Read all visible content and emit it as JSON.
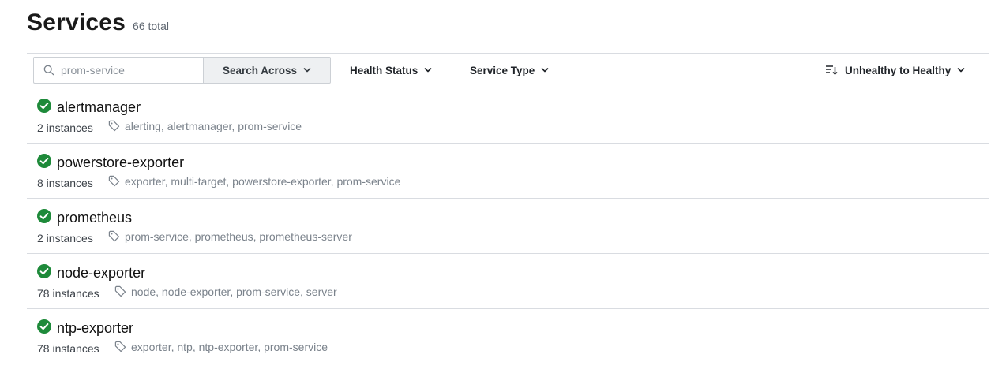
{
  "header": {
    "title": "Services",
    "total": "66 total"
  },
  "filters": {
    "search_placeholder": "prom-service",
    "search_across": "Search Across",
    "health_status": "Health Status",
    "service_type": "Service Type",
    "sort": "Unhealthy to Healthy"
  },
  "colors": {
    "healthy": "#1e8a3a"
  },
  "services": [
    {
      "name": "alertmanager",
      "instances": "2 instances",
      "tags": "alerting, alertmanager, prom-service",
      "status": "healthy"
    },
    {
      "name": "powerstore-exporter",
      "instances": "8 instances",
      "tags": "exporter, multi-target, powerstore-exporter, prom-service",
      "status": "healthy"
    },
    {
      "name": "prometheus",
      "instances": "2 instances",
      "tags": "prom-service, prometheus, prometheus-server",
      "status": "healthy"
    },
    {
      "name": "node-exporter",
      "instances": "78 instances",
      "tags": "node, node-exporter, prom-service, server",
      "status": "healthy"
    },
    {
      "name": "ntp-exporter",
      "instances": "78 instances",
      "tags": "exporter, ntp, ntp-exporter, prom-service",
      "status": "healthy"
    }
  ]
}
